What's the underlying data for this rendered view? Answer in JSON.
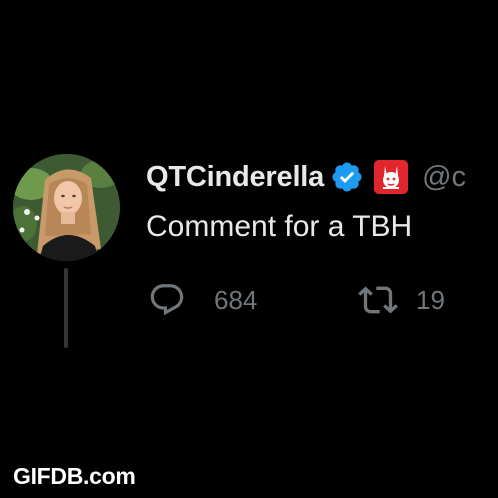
{
  "tweet": {
    "display_name": "QTCinderella",
    "handle": "@c",
    "text": "Comment for a TBH",
    "reply_count": "684",
    "retweet_count": "19"
  },
  "icons": {
    "avatar": "profile-photo",
    "verified": "verified-badge-icon",
    "affiliate": "affiliate-badge-icon",
    "reply": "reply-icon",
    "retweet": "retweet-icon"
  },
  "colors": {
    "background": "#000000",
    "text_primary": "#e7e9ea",
    "text_secondary": "#71767b",
    "verified_blue": "#1d9bf0",
    "affiliate_red": "#e0272e",
    "thread_line": "#333639"
  },
  "watermark": "GIFDB.com"
}
